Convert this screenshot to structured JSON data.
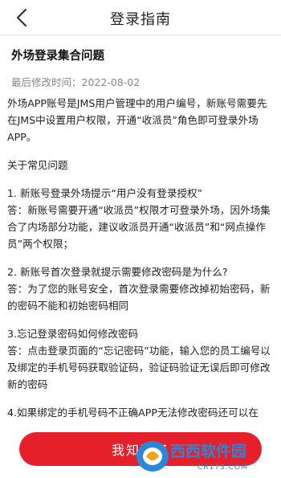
{
  "header": {
    "title": "登录指南"
  },
  "article": {
    "title": "外场登录集合问题",
    "modified_label": "最后修改时间：",
    "modified_date": "2022-08-02",
    "intro": "外场APP账号是JMS用户管理中的用户编号，新账号需要先在JMS中设置用户权限，开通“收派员”角色即可登录外场APP。",
    "faq_heading": "关于常见问题",
    "faqs": [
      {
        "question": "1. 新账号登录外场提示“用户没有登录授权”",
        "answer": "答：新账号需要开通“收派员”权限才可登录外场，因外场集合了内场部分功能，建议收派员开通“收派员”和“网点操作员”两个权限；"
      },
      {
        "question": "2. 新账号首次登录就提示需要修改密码是为什么?",
        "answer": "答：为了您的账号安全，首次登录需要修改掉初始密码，新的密码不能和初始密码相同"
      },
      {
        "question": "3.忘记登录密码如何修改密码",
        "answer": "答：点击登录页面的“忘记密码”功能，输入您的员工编号以及绑定的手机号码获取验证码，验证码验证无误后即可修改新的密码"
      },
      {
        "question": "4.如果绑定的手机号码不正确APP无法修改密码还可以在",
        "answer": ""
      }
    ]
  },
  "bottom": {
    "button_label": "我知道了"
  },
  "watermark": {
    "brand": "西西软件园",
    "url": "CR173.COM"
  },
  "colors": {
    "accent": "#e6202a",
    "muted": "#888888"
  },
  "icons": {
    "back": "chevron-left-icon"
  }
}
